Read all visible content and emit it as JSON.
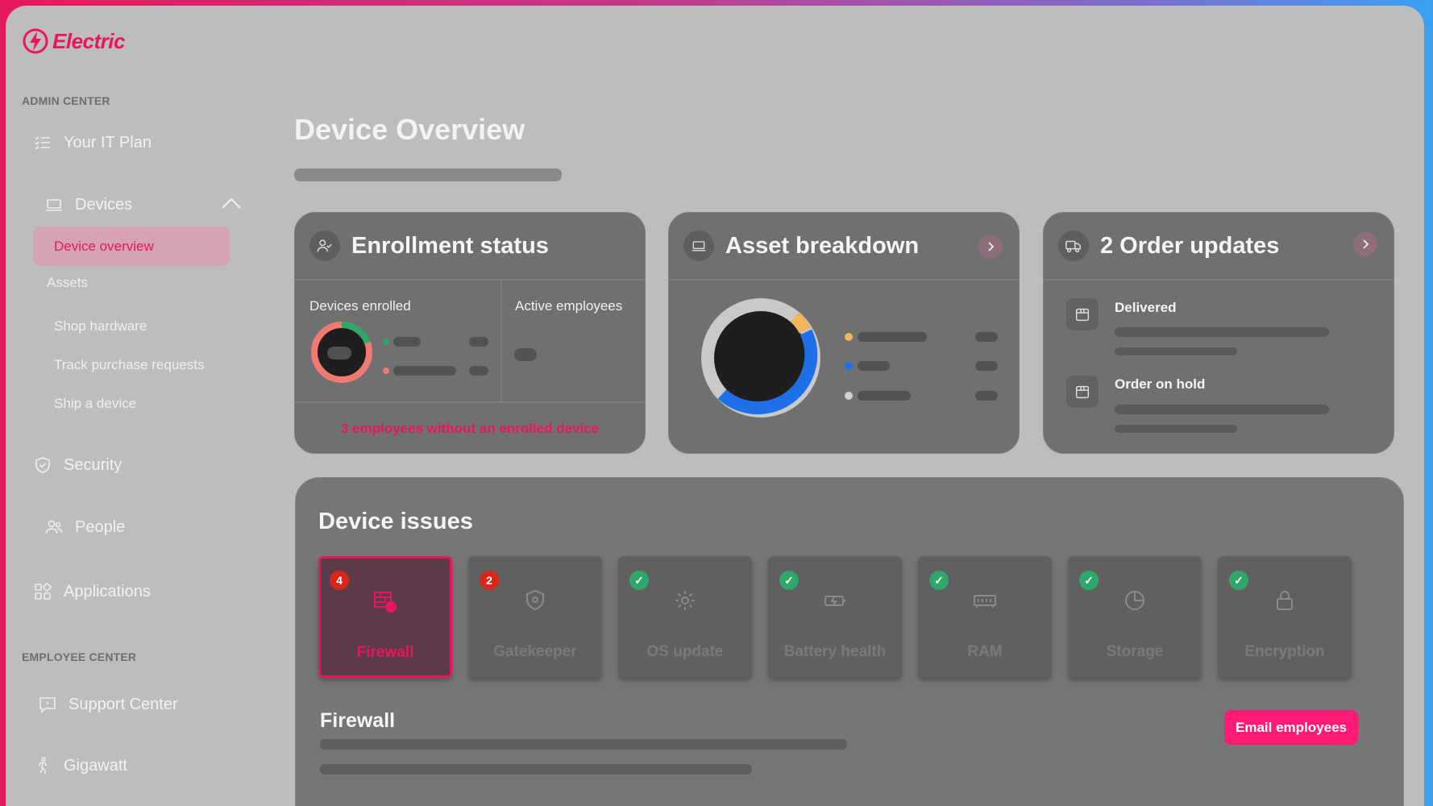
{
  "brand": {
    "name": "Electric",
    "color": "#e8175d"
  },
  "sidebar": {
    "admin_label": "ADMIN CENTER",
    "employee_label": "EMPLOYEE CENTER",
    "items": [
      {
        "label": "Your IT Plan",
        "icon": "list-check-icon"
      },
      {
        "label": "Devices",
        "icon": "laptop-icon"
      },
      {
        "label": "Security",
        "icon": "shield-check-icon"
      },
      {
        "label": "People",
        "icon": "people-icon"
      },
      {
        "label": "Applications",
        "icon": "apps-grid-icon"
      },
      {
        "label": "Support Center",
        "icon": "support-chat-icon"
      },
      {
        "label": "Gigawatt",
        "icon": "runner-icon"
      }
    ],
    "devices_sub": [
      "Device overview",
      "Assets",
      "Shop hardware",
      "Track purchase requests",
      "Ship a device"
    ]
  },
  "page": {
    "title": "Device Overview"
  },
  "enrollment": {
    "title": "Enrollment status",
    "devices_enrolled": "Devices enrolled",
    "active_employees": "Active employees",
    "warning": "3 employees without an enrolled device"
  },
  "assets": {
    "title": "Asset breakdown"
  },
  "orders": {
    "title": "2 Order updates",
    "items": [
      "Delivered",
      "Order on hold"
    ]
  },
  "issues": {
    "title": "Device issues",
    "tiles": [
      {
        "label": "Firewall",
        "badge": "4",
        "status": "issue"
      },
      {
        "label": "Gatekeeper",
        "badge": "2",
        "status": "issue"
      },
      {
        "label": "OS update",
        "status": "ok"
      },
      {
        "label": "Battery health",
        "status": "ok"
      },
      {
        "label": "RAM",
        "status": "ok"
      },
      {
        "label": "Storage",
        "status": "ok"
      },
      {
        "label": "Encryption",
        "status": "ok"
      }
    ],
    "selected_title": "Firewall",
    "email_button": "Email employees"
  }
}
